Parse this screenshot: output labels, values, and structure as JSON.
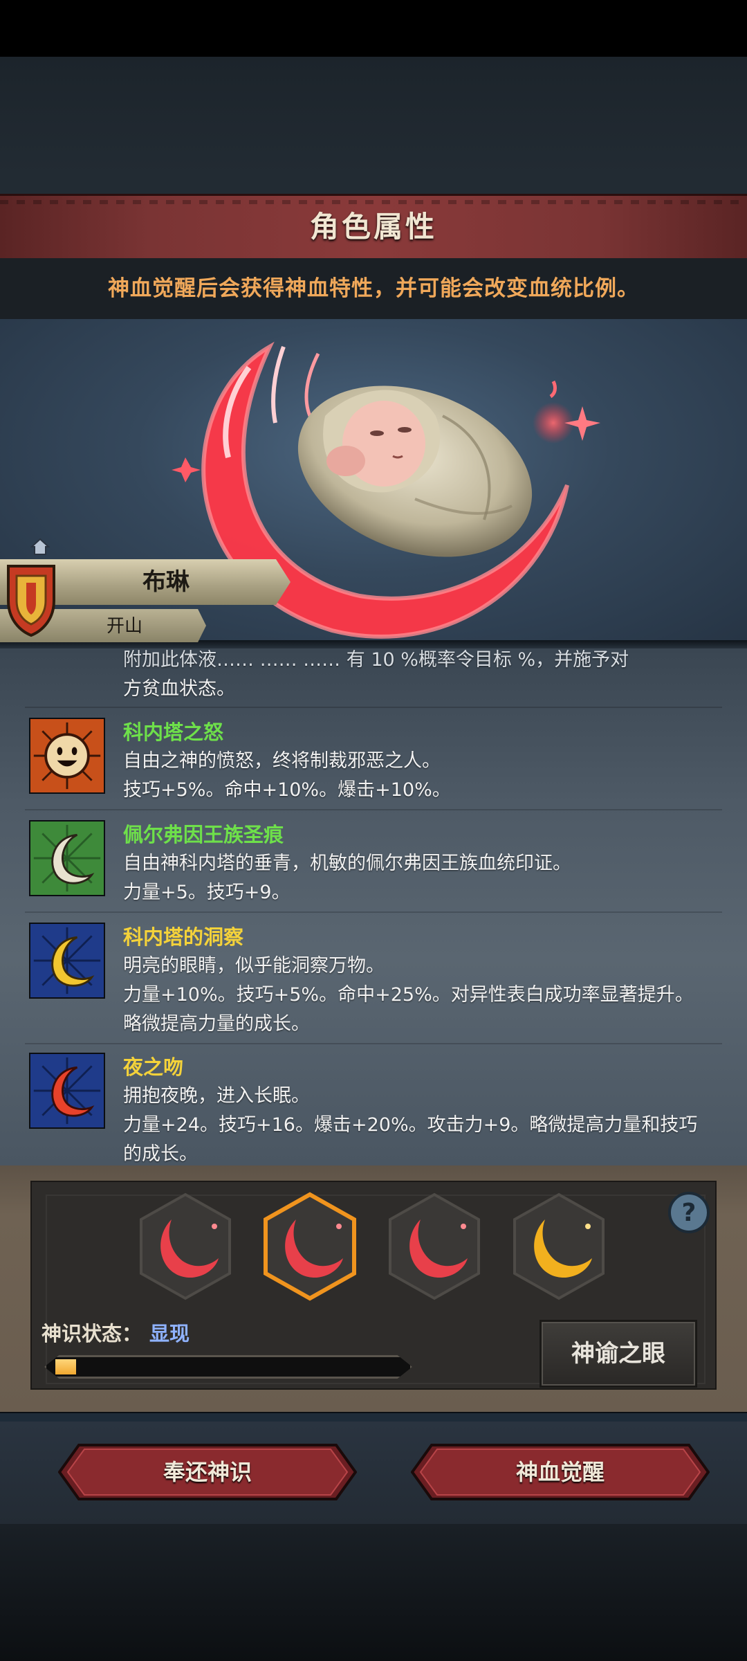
{
  "header": {
    "title": "角色属性",
    "notice": "神血觉醒后会获得神血特性，并可能会改变血统比例。"
  },
  "character": {
    "name": "布琳",
    "sub_label": "开山"
  },
  "traits": {
    "partial": {
      "line1": "附加此体液……  ……  …… 有 10 %概率令目标  %，并施予对",
      "line2": "方贫血状态。"
    },
    "items": [
      {
        "name": "科内塔之怒",
        "name_color": "#6ee04a",
        "icon": "smiling-sun-icon",
        "lines": [
          "自由之神的愤怒，终将制裁邪恶之人。",
          "技巧+5%。命中+10%。爆击+10%。"
        ]
      },
      {
        "name": "佩尔弗因王族圣痕",
        "name_color": "#6ee04a",
        "icon": "white-crescent-icon",
        "lines": [
          "自由神科内塔的垂青，机敏的佩尔弗因王族血统印证。",
          "力量+5。技巧+9。"
        ]
      },
      {
        "name": "科内塔的洞察",
        "name_color": "#f4d23a",
        "icon": "gold-crescent-icon",
        "lines": [
          "明亮的眼睛，似乎能洞察万物。",
          "力量+10%。技巧+5%。命中+25%。对异性表白成功率显著提升。",
          "略微提高力量的成长。"
        ]
      },
      {
        "name": "夜之吻",
        "name_color": "#f4d23a",
        "icon": "red-crescent-icon",
        "lines": [
          "拥抱夜晚，进入长眠。",
          "力量+24。技巧+16。爆击+20%。攻击力+9。略微提高力量和技巧",
          "的成长。"
        ]
      }
    ]
  },
  "god_sense": {
    "slots": [
      {
        "icon": "red-crescent-sigil-icon",
        "color": "#e8404a",
        "selected": false
      },
      {
        "icon": "red-crescent-sigil-icon",
        "color": "#e8404a",
        "selected": true
      },
      {
        "icon": "red-crescent-sigil-icon",
        "color": "#e8404a",
        "selected": false
      },
      {
        "icon": "gold-crescent-sigil-icon",
        "color": "#f2b01e",
        "selected": false
      }
    ],
    "status_label": "神识状态：",
    "status_value": "显现",
    "progress_fraction": 0.06,
    "oracle_button": "神谕之眼",
    "help_icon": "question-mark-icon"
  },
  "actions": {
    "return_button": "奉还神识",
    "awaken_button": "神血觉醒"
  }
}
